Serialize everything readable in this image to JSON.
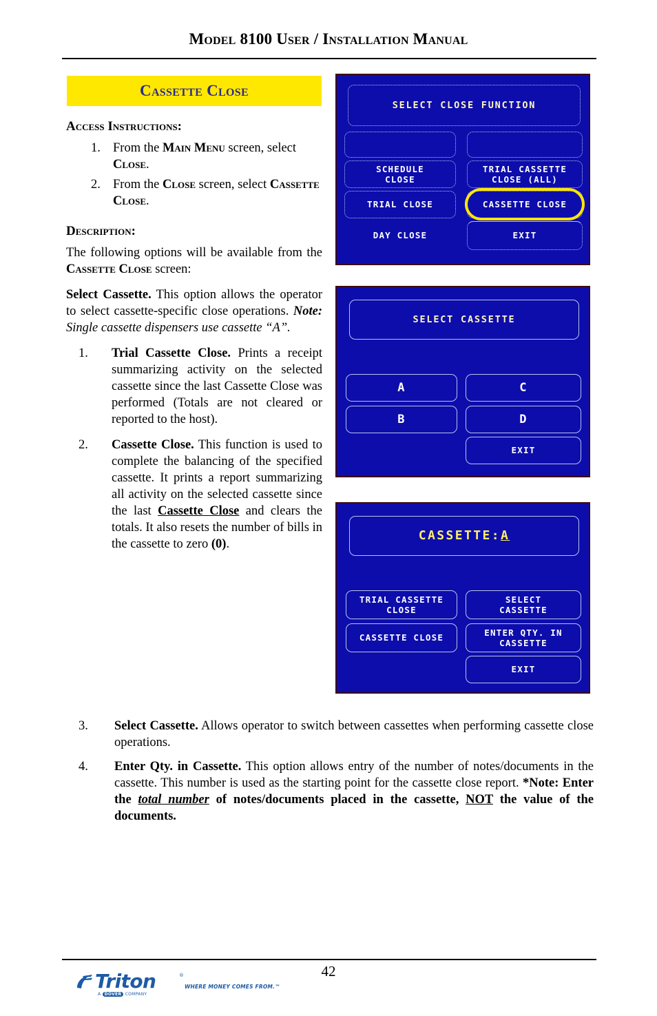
{
  "header": {
    "title": "Model 8100 User / Installation Manual"
  },
  "banner": {
    "title": "Cassette Close"
  },
  "access": {
    "heading": "Access Instructions:",
    "items": [
      {
        "num": "1.",
        "text_parts": [
          "From the ",
          "Main Menu",
          " screen, select ",
          "Close",
          "."
        ]
      },
      {
        "num": "2.",
        "text_parts": [
          "From the ",
          "Close",
          " screen, select ",
          "Cassette Close",
          "."
        ]
      }
    ]
  },
  "description": {
    "heading": "Description:",
    "intro_a": "The following options will be available from the ",
    "intro_sc": "Cassette Close",
    "intro_b": " screen:",
    "select_cassette_bold": "Select Cassette.",
    "select_cassette_body": "  This option allows the operator to select  cassette-specific close operations. ",
    "note_label": "Note:",
    "note_italic": " Single cassette dispensers use cassette “A”."
  },
  "options": [
    {
      "num": "1.",
      "bold": "Trial Cassette Close.",
      "body": " Prints a receipt summarizing activity on the selected cassette since the last Cassette Close was performed  (Totals are not cleared or reported to the host)."
    },
    {
      "num": "2.",
      "bold": "Cassette Close.",
      "body_a": " This function is used to complete the balancing of the specified cassette. It prints a report summarizing all activity on the selected cassette since the last ",
      "underline_bold": "Cassette Close",
      "body_b": " and clears the totals. It also resets the number of bills in the cassette to zero ",
      "bold_tail": "(0)",
      "body_c": "."
    },
    {
      "num": "3.",
      "bold": "Select Cassette.",
      "body": "  Allows operator to switch between cassettes when performing cassette close operations."
    },
    {
      "num": "4.",
      "bold": "Enter Qty. in Cassette.",
      "body_a": "  This option allows entry of the number of notes/documents in the cassette. This number is used as the starting point for the cassette close report. ",
      "note_bold_a": "*Note: Enter the ",
      "note_ul_ital": "total number",
      "note_bold_b": " of notes/documents placed in the cassette, ",
      "note_ul": "NOT",
      "note_bold_c": " the value of the documents."
    }
  ],
  "screens": [
    {
      "name": "select-close-function",
      "title": "SELECT CLOSE FUNCTION",
      "buttons": {
        "blank_left": "",
        "blank_right": "",
        "schedule_close": "SCHEDULE\nCLOSE",
        "trial_cassette_close_all": "TRIAL CASSETTE\nCLOSE (ALL)",
        "trial_close": "TRIAL CLOSE",
        "cassette_close": "CASSETTE CLOSE",
        "day_close": "DAY CLOSE",
        "exit": "EXIT"
      },
      "highlighted": "CASSETTE CLOSE"
    },
    {
      "name": "select-cassette",
      "title": "SELECT CASSETTE",
      "buttons": {
        "a": "A",
        "b": "B",
        "c": "C",
        "d": "D",
        "exit": "EXIT"
      }
    },
    {
      "name": "cassette-a",
      "title": "CASSETTE:A",
      "title_plain": "CASSETTE:",
      "title_underlined": "A",
      "buttons": {
        "trial_cassette_close": "TRIAL CASSETTE\nCLOSE",
        "select_cassette": "SELECT\nCASSETTE",
        "cassette_close": "CASSETTE CLOSE",
        "enter_qty_in_cassette": "ENTER QTY. IN\nCASSETTE",
        "exit": "EXIT"
      }
    }
  ],
  "footer": {
    "page_number": "42",
    "logo_word": "Triton",
    "logo_registered": "®",
    "logo_tagline": "WHERE MONEY COMES FROM.™",
    "logo_dover_pre": "A",
    "logo_dover_chip": "DOVER",
    "logo_dover_post": "COMPANY"
  },
  "colors": {
    "banner_bg": "#ffe800",
    "banner_text": "#2b2b8f",
    "screen_bg": "#0d0dac",
    "screen_border": "#3c0b14",
    "highlight": "#ffe700",
    "title_text": "#fff7c0",
    "button_text": "#ffffff",
    "logo_blue": "#1d5ba4"
  }
}
